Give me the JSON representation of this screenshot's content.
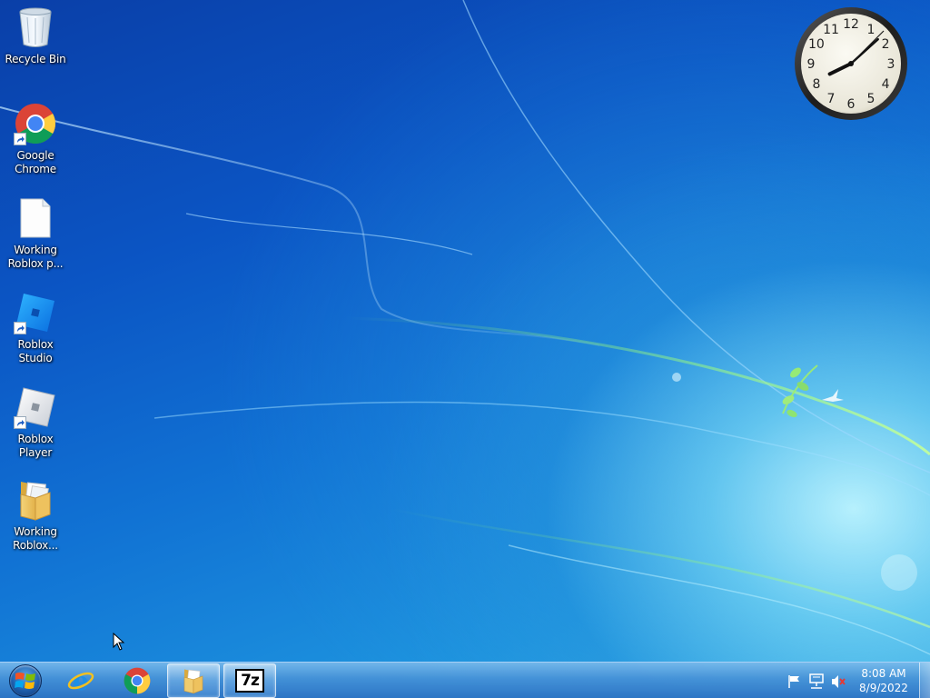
{
  "desktop": {
    "icons": [
      {
        "label": "Recycle Bin",
        "icon": "recycle-bin-icon"
      },
      {
        "label": "Google Chrome",
        "icon": "chrome-icon"
      },
      {
        "label": "Working Roblox p...",
        "icon": "blank-file-icon"
      },
      {
        "label": "Roblox Studio",
        "icon": "roblox-studio-icon"
      },
      {
        "label": "Roblox Player",
        "icon": "roblox-player-icon"
      },
      {
        "label": "Working Roblox...",
        "icon": "folder-icon"
      }
    ]
  },
  "clock_gadget": {
    "numerals": [
      "12",
      "1",
      "2",
      "3",
      "4",
      "5",
      "6",
      "7",
      "8",
      "9",
      "10",
      "11"
    ],
    "time": "8:08"
  },
  "taskbar": {
    "start_icon": "windows-logo-icon",
    "pinned": [
      {
        "icon": "internet-explorer-icon",
        "active": false
      },
      {
        "icon": "chrome-icon",
        "active": false
      },
      {
        "icon": "folder-icon",
        "active": true
      },
      {
        "icon": "7zip-icon",
        "active": true,
        "label": "7z"
      }
    ],
    "tray": {
      "icons": [
        "action-center-flag-icon",
        "network-icon",
        "volume-muted-icon"
      ],
      "time": "8:08 AM",
      "date": "8/9/2022"
    }
  }
}
